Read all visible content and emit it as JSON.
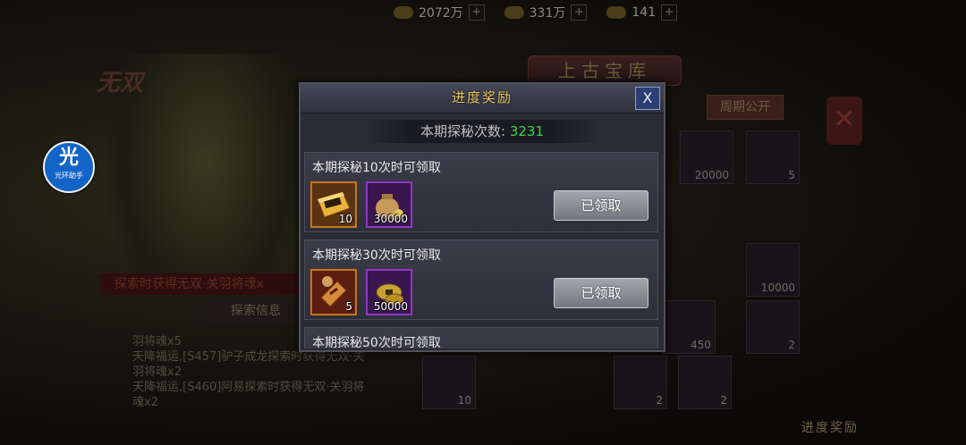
{
  "background": {
    "resources": [
      {
        "icon": "ingot-icon",
        "value": "2072万"
      },
      {
        "icon": "coin-icon",
        "value": "331万"
      },
      {
        "icon": "gem-icon",
        "value": "141"
      }
    ],
    "resource_plus": "+",
    "wushuang_label": "无双",
    "shop_title": "上古宝库",
    "publish_button": "周期公开",
    "slots": [
      {
        "qty": "20000"
      },
      {
        "qty": "5"
      },
      {
        "qty": "10000"
      },
      {
        "qty": "450"
      },
      {
        "qty": "2"
      },
      {
        "qty": "10"
      },
      {
        "qty": "2"
      },
      {
        "qty": "2"
      }
    ],
    "banner_text": "探索时获得无双·关羽将魂x",
    "tab_label": "探索信息",
    "log_lines": [
      "羽将魂x5",
      "天降福运,[S457]驴子成龙探索时获得无双·关",
      "羽将魂x2",
      "天降福运,[S460]阿易探索时获得无双·关羽将",
      "魂x2"
    ],
    "bottom_title": "进度奖励",
    "helper_glyph": "光",
    "helper_label": "光环助手"
  },
  "modal": {
    "title": "进度奖励",
    "close_label": "X",
    "count_label": "本期探秘次数:",
    "count_value": "3231",
    "rewards": [
      {
        "description": "本期探秘10次时可领取",
        "items": [
          {
            "icon": "gold-bar-icon",
            "quality": "orange",
            "qty": "10"
          },
          {
            "icon": "money-bag-icon",
            "quality": "purple",
            "qty": "30000"
          }
        ],
        "button_label": "已领取"
      },
      {
        "description": "本期探秘30次时可领取",
        "items": [
          {
            "icon": "scroll-token-icon",
            "quality": "orange",
            "qty": "5"
          },
          {
            "icon": "copper-coins-icon",
            "quality": "purple",
            "qty": "50000"
          }
        ],
        "button_label": "已领取"
      },
      {
        "description": "本期探秘50次时可领取",
        "items": [],
        "button_label": ""
      }
    ]
  },
  "colors": {
    "title_gold": "#e8c764",
    "count_green": "#3bd34a",
    "quality_orange": "#c9731d",
    "quality_purple": "#8f38c4",
    "close_blue": "#2c3f73"
  }
}
